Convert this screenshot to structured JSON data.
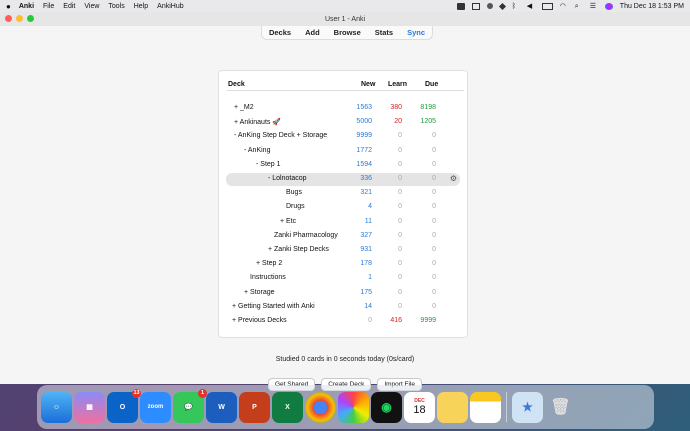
{
  "menubar": {
    "apple": "",
    "items": [
      "Anki",
      "File",
      "Edit",
      "View",
      "Tools",
      "Help",
      "AnkiHub"
    ],
    "clock": "Thu Dec 18  1:53 PM"
  },
  "window": {
    "title": "User 1 - Anki"
  },
  "toolbar": {
    "decks": "Decks",
    "add": "Add",
    "browse": "Browse",
    "stats": "Stats",
    "sync": "Sync"
  },
  "table": {
    "headers": {
      "deck": "Deck",
      "new": "New",
      "learn": "Learn",
      "due": "Due"
    },
    "rows": [
      {
        "prefix": "+",
        "name": "_M2",
        "new": "1563",
        "learn": "380",
        "due": "8198"
      },
      {
        "prefix": "+",
        "name": "Ankinauts 🚀",
        "new": "5000",
        "learn": "20",
        "due": "1205"
      },
      {
        "prefix": "-",
        "name": "AnKing Step Deck + Storage",
        "new": "9999",
        "learn": "0",
        "due": "0"
      },
      {
        "prefix": "-",
        "name": "AnKing",
        "new": "1772",
        "learn": "0",
        "due": "0"
      },
      {
        "prefix": "-",
        "name": "Step 1",
        "new": "1594",
        "learn": "0",
        "due": "0"
      },
      {
        "prefix": "-",
        "name": "Lolnotacop",
        "new": "336",
        "learn": "0",
        "due": "0"
      },
      {
        "prefix": "",
        "name": "Bugs",
        "new": "321",
        "learn": "0",
        "due": "0"
      },
      {
        "prefix": "",
        "name": "Drugs",
        "new": "4",
        "learn": "0",
        "due": "0"
      },
      {
        "prefix": "+",
        "name": "Etc",
        "new": "11",
        "learn": "0",
        "due": "0"
      },
      {
        "prefix": "",
        "name": "Zanki Pharmacology",
        "new": "327",
        "learn": "0",
        "due": "0"
      },
      {
        "prefix": "+",
        "name": "Zanki Step Decks",
        "new": "931",
        "learn": "0",
        "due": "0"
      },
      {
        "prefix": "+",
        "name": "Step 2",
        "new": "178",
        "learn": "0",
        "due": "0"
      },
      {
        "prefix": "",
        "name": "Instructions",
        "new": "1",
        "learn": "0",
        "due": "0"
      },
      {
        "prefix": "+",
        "name": "Storage",
        "new": "175",
        "learn": "0",
        "due": "0"
      },
      {
        "prefix": "+",
        "name": "Getting Started with Anki",
        "new": "14",
        "learn": "0",
        "due": "0"
      },
      {
        "prefix": "+",
        "name": "Previous Decks",
        "new": "0",
        "learn": "416",
        "due": "9999"
      }
    ]
  },
  "studied": "Studied 0 cards in 0 seconds today (0s/card)",
  "buttons": {
    "get_shared": "Get Shared",
    "create_deck": "Create Deck",
    "import_file": "Import File"
  },
  "dock": {
    "outlook_badge": "13",
    "messages_badge": "1",
    "zoom_label": "zoom",
    "calendar_month": "DEC",
    "calendar_day": "18"
  },
  "colors": {
    "accent": "#2a7ad6",
    "learn_red": "#d82020",
    "due_green": "#1f9a3a"
  }
}
